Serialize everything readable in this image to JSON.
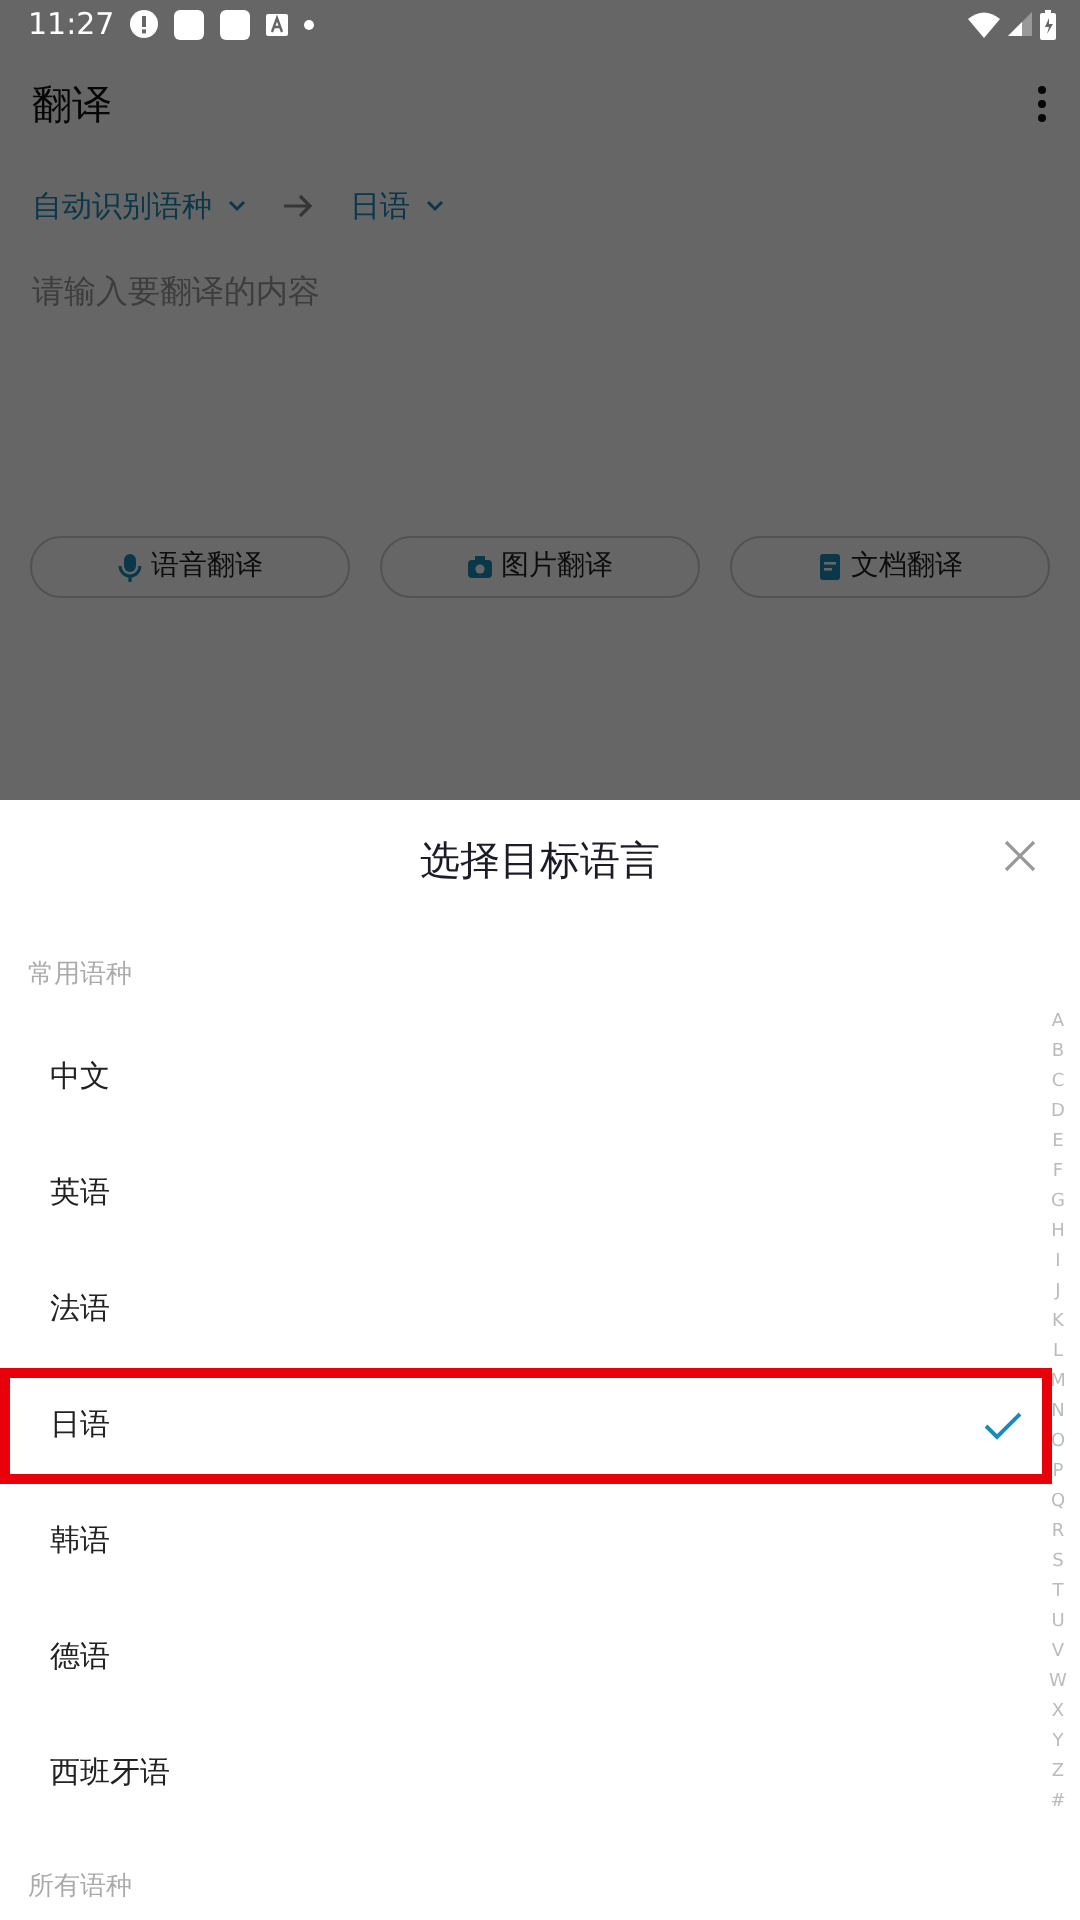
{
  "status_bar": {
    "time": "11:27"
  },
  "app_bar": {
    "title": "翻译"
  },
  "language_bar": {
    "source": "自动识别语种",
    "target": "日语"
  },
  "input": {
    "placeholder": "请输入要翻译的内容"
  },
  "actions": [
    {
      "kind": "voice",
      "label": "语音翻译"
    },
    {
      "kind": "image",
      "label": "图片翻译"
    },
    {
      "kind": "document",
      "label": "文档翻译"
    }
  ],
  "sheet": {
    "title": "选择目标语言",
    "sections": [
      {
        "heading": "常用语种",
        "items": [
          {
            "label": "中文",
            "selected": false,
            "highlighted": false
          },
          {
            "label": "英语",
            "selected": false,
            "highlighted": false
          },
          {
            "label": "法语",
            "selected": false,
            "highlighted": false
          },
          {
            "label": "日语",
            "selected": true,
            "highlighted": true
          },
          {
            "label": "韩语",
            "selected": false,
            "highlighted": false
          },
          {
            "label": "德语",
            "selected": false,
            "highlighted": false
          },
          {
            "label": "西班牙语",
            "selected": false,
            "highlighted": false
          }
        ]
      },
      {
        "heading": "所有语种"
      }
    ],
    "index": [
      "A",
      "B",
      "C",
      "D",
      "E",
      "F",
      "G",
      "H",
      "I",
      "J",
      "K",
      "L",
      "M",
      "N",
      "O",
      "P",
      "Q",
      "R",
      "S",
      "T",
      "U",
      "V",
      "W",
      "X",
      "Y",
      "Z",
      "#"
    ]
  }
}
